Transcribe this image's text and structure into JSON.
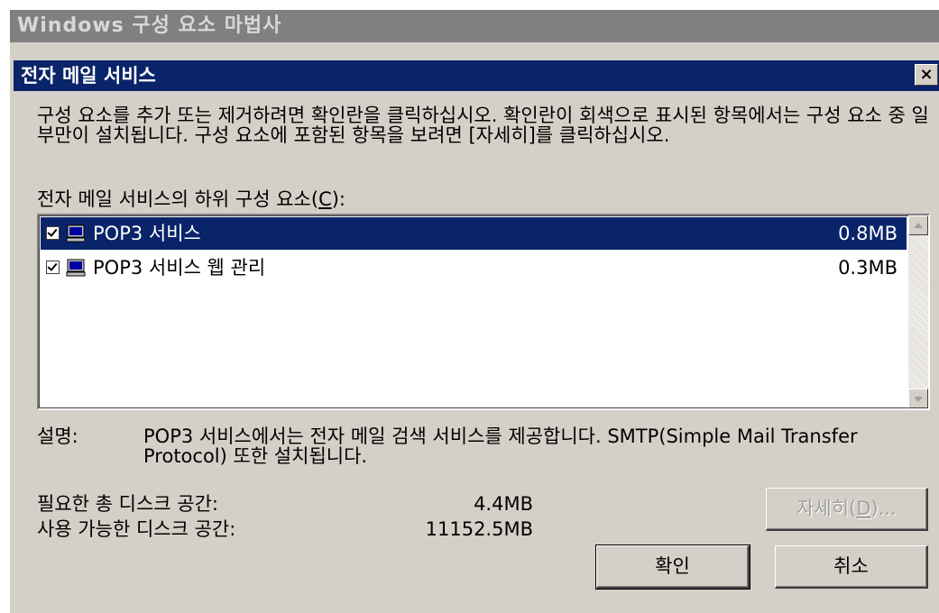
{
  "wizard": {
    "title": "Windows 구성 요소 마법사"
  },
  "dialog": {
    "title": "전자 메일 서비스",
    "close_label": "×",
    "instructions": "구성 요소를 추가 또는 제거하려면 확인란을 클릭하십시오. 확인란이 회색으로 표시된 항목에서는 구성 요소 중 일부만이 설치됩니다. 구성 요소에 포함된 항목을 보려면 [자세히]를 클릭하십시오.",
    "list_label_prefix": "전자 메일 서비스의 하위 구성 요소(",
    "list_label_accel": "C",
    "list_label_suffix": "):",
    "components": [
      {
        "name": "POP3 서비스",
        "size": "0.8MB",
        "checked": true,
        "selected": true,
        "icon": "computer-icon"
      },
      {
        "name": "POP3 서비스 웹 관리",
        "size": "0.3MB",
        "checked": true,
        "selected": false,
        "icon": "computer-icon"
      }
    ],
    "description_label": "설명:",
    "description": "POP3 서비스에서는 전자 메일 검색 서비스를 제공합니다. SMTP(Simple Mail Transfer Protocol) 또한 설치됩니다.",
    "required_space_label": "필요한 총 디스크 공간:",
    "required_space_value": "4.4MB",
    "available_space_label": "사용 가능한 디스크 공간:",
    "available_space_value": "11152.5MB",
    "details_button_prefix": "자세히(",
    "details_button_accel": "D",
    "details_button_suffix": ")...",
    "ok_button": "확인",
    "cancel_button": "취소"
  }
}
